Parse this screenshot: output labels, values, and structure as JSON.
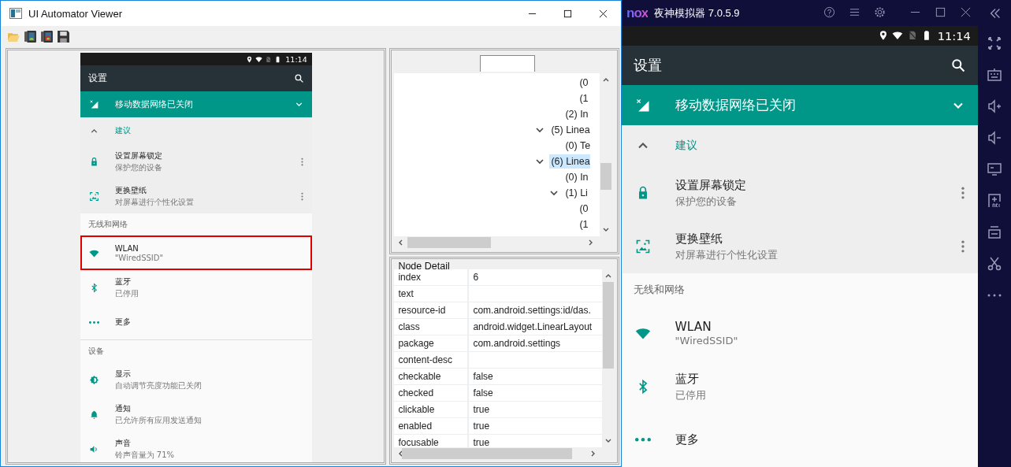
{
  "viewer": {
    "title": "UI Automator Viewer",
    "screen": {
      "status_time": "11:14",
      "title": "设置",
      "banner": "移动数据网络已关闭",
      "suggestions_label": "建议",
      "suggestions": [
        {
          "kind": "lock",
          "title": "设置屏幕锁定",
          "subtitle": "保护您的设备"
        },
        {
          "kind": "wallpaper",
          "title": "更换壁纸",
          "subtitle": "对屏幕进行个性化设置"
        }
      ],
      "sections": [
        {
          "header": "无线和网络",
          "items": [
            {
              "kind": "wifi",
              "title": "WLAN",
              "subtitle": "\"WiredSSID\"",
              "selected": true
            },
            {
              "kind": "bluetooth",
              "title": "蓝牙",
              "subtitle": "已停用",
              "selected": false
            },
            {
              "kind": "more",
              "title": "更多",
              "selected": false
            }
          ]
        },
        {
          "header": "设备",
          "items": [
            {
              "kind": "display",
              "title": "显示",
              "subtitle": "自动调节亮度功能已关闭",
              "selected": false
            },
            {
              "kind": "bell",
              "title": "通知",
              "subtitle": "已允许所有应用发送通知",
              "selected": false
            },
            {
              "kind": "volume",
              "title": "声音",
              "subtitle": "铃声音量为 71%",
              "selected": false
            }
          ]
        }
      ]
    },
    "tree": {
      "nodes": [
        {
          "children": [
            {
              "children": [
                {
                  "label": "(0",
                  "selected": false
                },
                {
                  "label": "(1",
                  "selected": false
                }
              ]
            },
            {
              "label": "(2) In",
              "selected": false
            }
          ]
        },
        {
          "label": "(5) Linea",
          "expanded": true,
          "selected": false,
          "children": [
            {
              "label": "(0) Te",
              "selected": false
            }
          ]
        },
        {
          "label": "(6) Linea",
          "expanded": true,
          "selected": true,
          "children": [
            {
              "label": "(0) In",
              "selected": false
            },
            {
              "label": "(1) Li",
              "expanded": true,
              "selected": false,
              "children": [
                {
                  "label": "(0",
                  "selected": false
                },
                {
                  "label": "(1",
                  "selected": false
                }
              ]
            }
          ]
        }
      ]
    },
    "node_detail": {
      "title": "Node Detail",
      "rows": [
        {
          "name": "index",
          "value": "6"
        },
        {
          "name": "text"
        },
        {
          "name": "resource-id",
          "value": "com.android.settings:id/das."
        },
        {
          "name": "class",
          "value": "android.widget.LinearLayout"
        },
        {
          "name": "package",
          "value": "com.android.settings"
        },
        {
          "name": "content-desc"
        },
        {
          "name": "checkable",
          "value": "false"
        },
        {
          "name": "checked",
          "value": "false"
        },
        {
          "name": "clickable",
          "value": "true"
        },
        {
          "name": "enabled",
          "value": "true"
        },
        {
          "name": "focusable",
          "value": "true"
        }
      ]
    }
  },
  "emulator": {
    "logo": "nox",
    "title": "夜神模拟器 7.0.5.9",
    "screen": {
      "status_time": "11:14",
      "title": "设置",
      "banner": "移动数据网络已关闭",
      "suggestions_label": "建议",
      "suggestions": [
        {
          "kind": "lock",
          "title": "设置屏幕锁定",
          "subtitle": "保护您的设备"
        },
        {
          "kind": "wallpaper",
          "title": "更换壁纸",
          "subtitle": "对屏幕进行个性化设置"
        }
      ],
      "sections": [
        {
          "header": "无线和网络",
          "items": [
            {
              "kind": "wifi",
              "title": "WLAN",
              "subtitle": "\"WiredSSID\""
            },
            {
              "kind": "bluetooth",
              "title": "蓝牙",
              "subtitle": "已停用"
            },
            {
              "kind": "more",
              "title": "更多"
            }
          ]
        }
      ]
    }
  }
}
